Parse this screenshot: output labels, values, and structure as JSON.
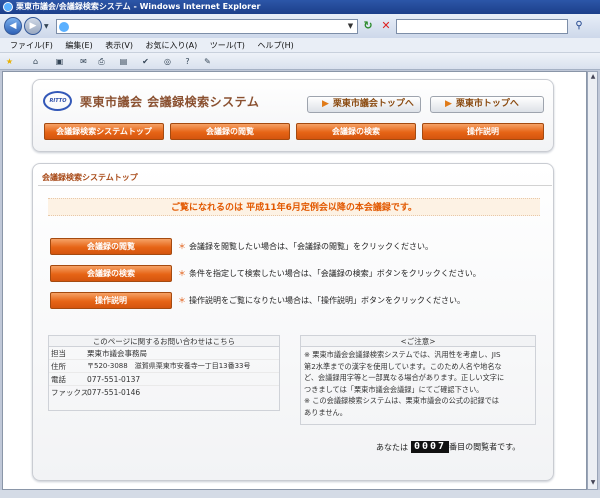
{
  "window": {
    "title": "栗東市議会/会議録検索システム - Windows Internet Explorer"
  },
  "browser": {
    "address": "",
    "search_placeholder": "",
    "menu": [
      "ファイル(F)",
      "編集(E)",
      "表示(V)",
      "お気に入り(A)",
      "ツール(T)",
      "ヘルプ(H)"
    ]
  },
  "site": {
    "title": "栗東市議会 会議録検索システム",
    "logo_text": "RITTO",
    "top_links": [
      "栗東市議会トップへ",
      "栗東市トップへ"
    ],
    "nav": [
      "会議録検索システムトップ",
      "会議録の閲覧",
      "会議録の検索",
      "操作説明"
    ]
  },
  "main": {
    "section_title": "会議録検索システムトップ",
    "notice": "ご覧になれるのは 平成11年6月定例会以降の本会議録です。",
    "actions": [
      {
        "button": "会議録の閲覧",
        "desc": "会議録を閲覧したい場合は、「会議録の閲覧」をクリックください。"
      },
      {
        "button": "会議録の検索",
        "desc": "条件を指定して検索したい場合は、「会議録の検索」ボタンをクリックください。"
      },
      {
        "button": "操作説明",
        "desc": "操作説明をご覧になりたい場合は、「操作説明」ボタンをクリックください。"
      }
    ],
    "bullet": "＊",
    "contact": {
      "heading": "このページに関するお問い合わせはこちら",
      "rows": [
        {
          "label": "担当",
          "value": "栗東市議会事務局"
        },
        {
          "label": "住所",
          "value": "〒520-3088　滋賀県栗東市安養寺一丁目13番33号"
        },
        {
          "label": "電話",
          "value": "077-551-0137"
        },
        {
          "label": "ファックス",
          "value": "077-551-0146"
        }
      ]
    },
    "caution": {
      "heading": "<ご注意>",
      "lines": [
        "※ 栗東市議会会議録検索システムでは、汎用性を考慮し、JIS",
        "第2水準までの漢字を使用しています。このため人名や地名な",
        "ど、会議録用字等と一部異なる場合があります。正しい文字に",
        "つきましては「栗東市議会会議録」にてご確認下さい。",
        "※ この会議録検索システムは、栗東市議会の公式の記録では",
        "ありません。"
      ]
    },
    "counter": {
      "prefix": "あなたは",
      "value": "0007",
      "suffix": "番目の閲覧者です。"
    }
  },
  "colors": {
    "accent": "#e66416",
    "title_brown": "#8a5030",
    "notice": "#e25800",
    "ie_blue": "#1c3f8a"
  }
}
